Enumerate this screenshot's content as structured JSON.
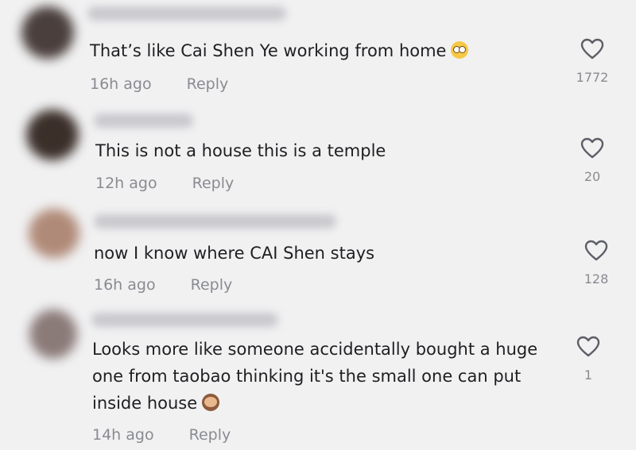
{
  "comments": [
    {
      "text": "That’s like Cai Shen Ye working from home",
      "emoji": "flushed-face-emoji",
      "time": "16h ago",
      "reply_label": "Reply",
      "likes": "1772",
      "avatar_color": "#4a3f3c"
    },
    {
      "text": "This is not a house this is a temple",
      "emoji": "",
      "time": "12h ago",
      "reply_label": "Reply",
      "likes": "20",
      "avatar_color": "#3b2f2a"
    },
    {
      "text": "now I know where CAI Shen stays",
      "emoji": "",
      "time": "16h ago",
      "reply_label": "Reply",
      "likes": "128",
      "avatar_color": "#b08a78"
    },
    {
      "text_lines": [
        "Looks more like someone accidentally bought a huge",
        "one from taobao thinking it's the small one can put",
        "inside house"
      ],
      "emoji": "see-no-evil-monkey-emoji",
      "time": "14h ago",
      "reply_label": "Reply",
      "likes": "1",
      "avatar_color": "#8a7a78"
    }
  ],
  "colors": {
    "background": "#f1f1f2",
    "text": "#1f1f22",
    "meta": "#8a8b91",
    "heart_outline": "#5d5e66"
  },
  "icons": {
    "like": "heart-outline-icon"
  }
}
